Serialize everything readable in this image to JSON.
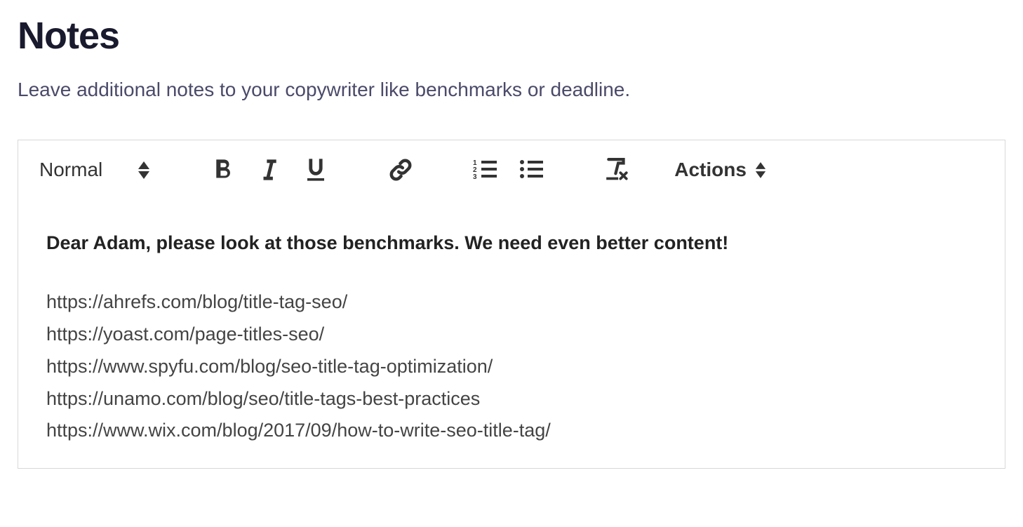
{
  "header": {
    "title": "Notes",
    "subtitle": "Leave additional notes to your copywriter like benchmarks or deadline."
  },
  "toolbar": {
    "styleSelect": "Normal",
    "actionsLabel": "Actions"
  },
  "editor": {
    "intro": "Dear Adam, please look at those benchmarks. We need even better content!",
    "links": [
      "https://ahrefs.com/blog/title-tag-seo/",
      "https://yoast.com/page-titles-seo/",
      "https://www.spyfu.com/blog/seo-title-tag-optimization/",
      "https://unamo.com/blog/seo/title-tags-best-practices",
      "https://www.wix.com/blog/2017/09/how-to-write-seo-title-tag/"
    ]
  }
}
